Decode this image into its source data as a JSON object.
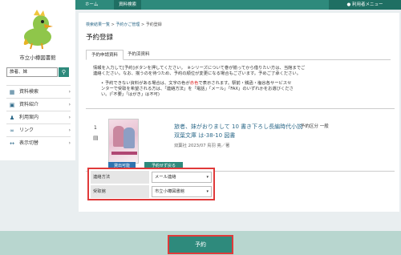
{
  "header": {
    "home": "ホーム",
    "catalog": "資料検索",
    "user_menu": "利用者メニュー",
    "user_icon": "person-icon"
  },
  "sidebar": {
    "library_name": "市立小樽図書館",
    "search_value": "旅者、妹",
    "search_icon": "search-icon",
    "items": [
      {
        "label": "資料検索",
        "icon": "book-search-icon"
      },
      {
        "label": "資料紹介",
        "icon": "book-icon"
      },
      {
        "label": "利用案内",
        "icon": "people-icon"
      },
      {
        "label": "リンク",
        "icon": "link-icon"
      },
      {
        "label": "表示切替",
        "icon": "switch-icon"
      }
    ]
  },
  "main": {
    "breadcrumb": [
      "検索結果一覧",
      "予約かご管理",
      "予約登録"
    ],
    "title": "予約登録",
    "tabs": [
      "予約申請資料",
      "予約済資料"
    ],
    "info_line1": "情報を入力して[予約]ボタンを押してください。　※シリーズについて巻が揃ってから借りたい方は、当館までご",
    "info_line2": "連絡ください。なお、揃うのを待つため、予約の順位が変更になる場合もございます。予めご了承ください。",
    "bullet_a": "予約できない資料がある場合は、文字の色が",
    "bullet_red": "赤色",
    "bullet_b": "で表示されます。駅前・銭函・塩谷各サービスセ",
    "bullet_line2": "ンターで受取を希望される方は、「連絡方法」を「電話」「メール」「FAX」のいずれかをお選びくださ",
    "bullet_line3": "い。(「不要」「はがき」は不可)"
  },
  "book": {
    "index": "1",
    "type_icon": "book-icon",
    "title": "旅者、妹がおりまして 10 書き下ろし長編時代小説",
    "series": "双葉文庫 は-38-10 図書",
    "meta": "双葉社 2023/07 鳥羽 亮／著",
    "reserve_section": "予約区分 一般",
    "available_label": "貸出可能",
    "return_label": "予約せず戻る"
  },
  "form": {
    "contact_label": "連絡方法",
    "contact_value": "メール連絡",
    "pickup_label": "受取館",
    "pickup_value": "市立小樽図書館"
  },
  "footer": {
    "reserve_label": "予約"
  }
}
